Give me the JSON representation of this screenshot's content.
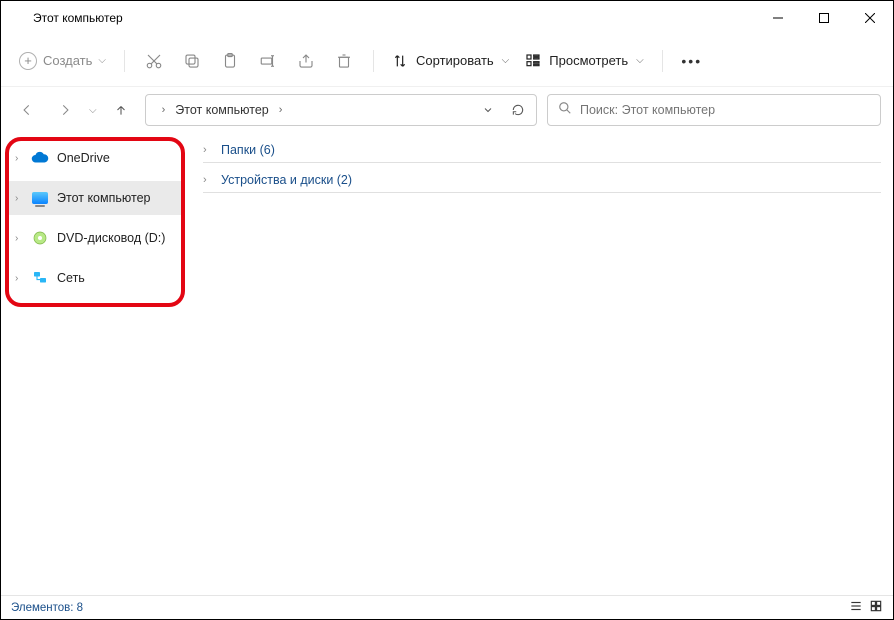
{
  "titlebar": {
    "title": "Этот компьютер"
  },
  "toolbar": {
    "new_label": "Создать",
    "sort_label": "Сортировать",
    "view_label": "Просмотреть"
  },
  "addressbar": {
    "location": "Этот компьютер"
  },
  "search": {
    "placeholder": "Поиск: Этот компьютер"
  },
  "sidebar": {
    "items": [
      {
        "label": "OneDrive",
        "icon": "cloud",
        "selected": false
      },
      {
        "label": "Этот компьютер",
        "icon": "pc",
        "selected": true
      },
      {
        "label": "DVD-дисковод (D:)",
        "icon": "dvd",
        "selected": false
      },
      {
        "label": "Сеть",
        "icon": "network",
        "selected": false
      }
    ]
  },
  "main": {
    "groups": [
      {
        "label": "Папки (6)"
      },
      {
        "label": "Устройства и диски (2)"
      }
    ]
  },
  "statusbar": {
    "text": "Элементов: 8"
  }
}
